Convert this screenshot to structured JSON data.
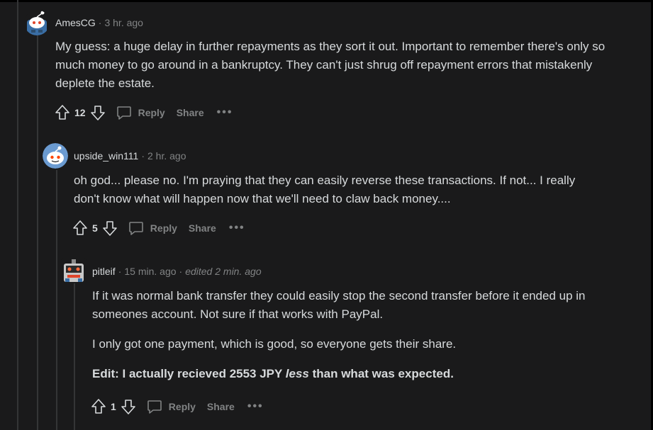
{
  "comments": [
    {
      "username": "AmesCG",
      "time": "3 hr. ago",
      "body": "My guess: a huge delay in further repayments as they sort it out. Important to remember there's only so much money to go around in a bankruptcy. They can't just shrug off repayment errors that mistakenly deplete the estate.",
      "score": "12",
      "reply_label": "Reply",
      "share_label": "Share",
      "more_label": "•••"
    },
    {
      "username": "upside_win111",
      "time": "2 hr. ago",
      "body": "oh god... please no. I'm praying that they can easily reverse these transactions. If not... I really don't know what will happen now that we'll need to claw back money....",
      "score": "5",
      "reply_label": "Reply",
      "share_label": "Share",
      "more_label": "•••"
    },
    {
      "username": "pitleif",
      "time": "15 min. ago",
      "edited": "edited 2 min. ago",
      "paragraph1": "If it was normal bank transfer they could easily stop the second transfer before it ended up in someones account. Not sure if that works with PayPal.",
      "paragraph2": "I only got one payment, which is good, so everyone gets their share.",
      "edit_prefix": "Edit: I actually recieved 2553 JPY ",
      "edit_emph": "less",
      "edit_suffix": " than what was expected.",
      "score": "1",
      "reply_label": "Reply",
      "share_label": "Share",
      "more_label": "•••"
    }
  ],
  "separator": "·"
}
